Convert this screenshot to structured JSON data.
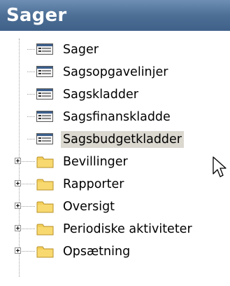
{
  "header": {
    "title": "Sager"
  },
  "tree": {
    "items": [
      {
        "label": "Sager",
        "icon": "form-icon",
        "selected": false
      },
      {
        "label": "Sagsopgavelinjer",
        "icon": "form-icon",
        "selected": false
      },
      {
        "label": "Sagskladder",
        "icon": "form-icon",
        "selected": false
      },
      {
        "label": "Sagsfinanskladde",
        "icon": "form-icon",
        "selected": false
      },
      {
        "label": "Sagsbudgetkladder",
        "icon": "form-icon",
        "selected": true
      },
      {
        "label": "Bevillinger",
        "icon": "folder-icon",
        "expandable": true
      },
      {
        "label": "Rapporter",
        "icon": "folder-icon",
        "expandable": true
      },
      {
        "label": "Oversigt",
        "icon": "folder-icon",
        "expandable": true
      },
      {
        "label": "Periodiske aktiviteter",
        "icon": "folder-icon",
        "expandable": true
      },
      {
        "label": "Opsætning",
        "icon": "folder-icon",
        "expandable": true
      }
    ]
  },
  "colors": {
    "header_bg": "#4d6f96",
    "header_text": "#ffffff",
    "selection_bg": "#dbd8d0",
    "folder_yellow": "#f3cf5a"
  }
}
